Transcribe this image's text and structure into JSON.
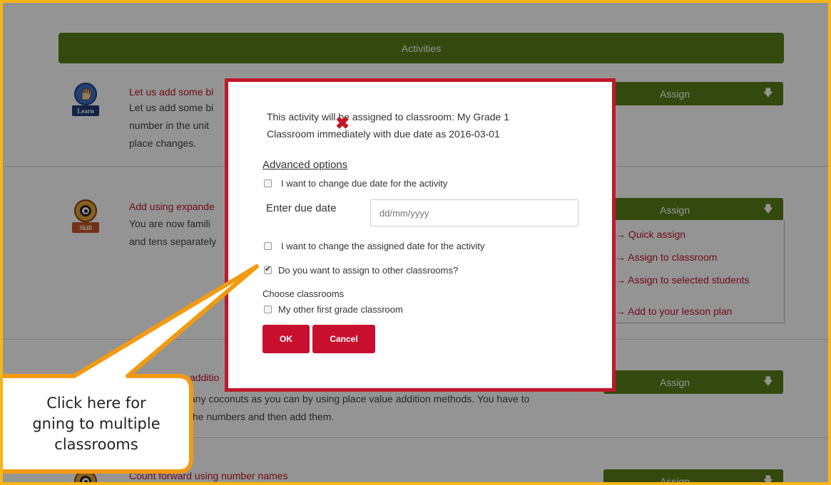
{
  "header": {
    "title": "Activities"
  },
  "activities": [
    {
      "badge": "Learn",
      "title": "Let us add some bi",
      "desc": [
        "Let us add some bi",
        "number in the unit",
        "place changes."
      ],
      "assign_label": "Assign"
    },
    {
      "badge": "Skill",
      "title": "Add using expande",
      "desc": [
        "You are now famili",
        "and tens separately"
      ],
      "assign_label": "Assign"
    },
    {
      "title": "additio",
      "desc": [
        "any coconuts as you can by using place value addition methods. You have to",
        "the numbers and then add them."
      ],
      "assign_label": "Assign"
    },
    {
      "title": "Count forward using number names",
      "assign_label": "Assign"
    }
  ],
  "assign_menu": {
    "items": [
      "Quick assign",
      "Assign to classroom",
      "Assign to selected students",
      "Add to your lesson plan"
    ]
  },
  "modal": {
    "message_line1": "This activity will be assigned to classroom: My Grade 1",
    "message_line2": "Classroom immediately with due date as 2016-03-01",
    "advanced_options": "Advanced options",
    "change_due_date": "I want to change due date for the activity",
    "due_date_label": "Enter due date",
    "due_date_placeholder": "dd/mm/yyyy",
    "change_assigned_date": "I want to change the assigned date for the activity",
    "assign_other": "Do you want to assign to other classrooms?",
    "choose_classrooms": "Choose classrooms",
    "other_classroom": "My other first grade classroom",
    "ok": "OK",
    "cancel": "Cancel"
  },
  "callout": {
    "line1": "Click here for",
    "line2": "gning to multiple",
    "line3": "classrooms"
  },
  "colors": {
    "accent_green": "#5a7f19",
    "accent_red": "#c0182b",
    "frame": "#f6b616"
  }
}
